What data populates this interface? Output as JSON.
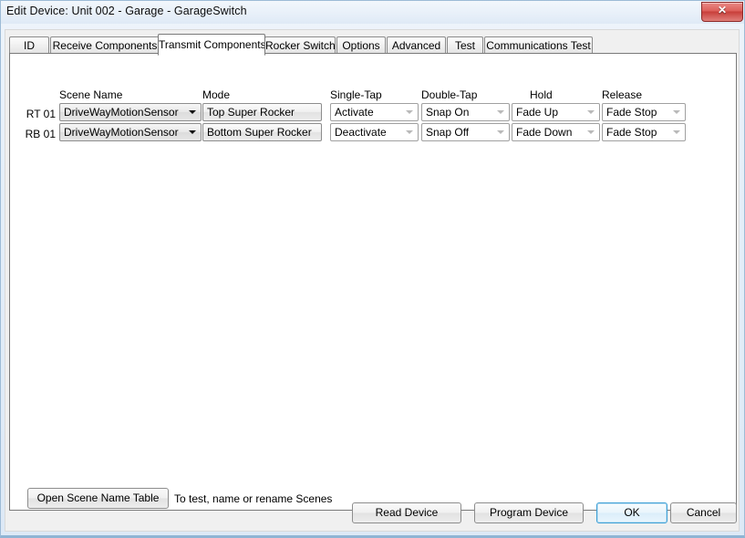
{
  "window": {
    "title": "Edit Device: Unit 002 - Garage - GarageSwitch",
    "close_glyph": "✕"
  },
  "tabs": [
    {
      "label": "ID",
      "active": false
    },
    {
      "label": "Receive Components",
      "active": false
    },
    {
      "label": "Transmit Components",
      "active": true
    },
    {
      "label": "Rocker Switch",
      "active": false
    },
    {
      "label": "Options",
      "active": false
    },
    {
      "label": "Advanced",
      "active": false
    },
    {
      "label": "Test",
      "active": false
    },
    {
      "label": "Communications Test",
      "active": false
    }
  ],
  "grid": {
    "headers": {
      "scene_name": "Scene Name",
      "mode": "Mode",
      "single_tap": "Single-Tap",
      "double_tap": "Double-Tap",
      "hold": "Hold",
      "release": "Release"
    },
    "rows": [
      {
        "label": "RT 01",
        "scene_name": "DriveWayMotionSensor",
        "mode": "Top Super Rocker",
        "single_tap": "Activate",
        "double_tap": "Snap On",
        "hold": "Fade Up",
        "release": "Fade Stop"
      },
      {
        "label": "RB 01",
        "scene_name": "DriveWayMotionSensor",
        "mode": "Bottom Super Rocker",
        "single_tap": "Deactivate",
        "double_tap": "Snap Off",
        "hold": "Fade Down",
        "release": "Fade Stop"
      }
    ]
  },
  "scene_table": {
    "button_label": "Open Scene Name Table",
    "hint": "To test, name or rename Scenes"
  },
  "footer": {
    "read_device": "Read Device",
    "program_device": "Program Device",
    "ok": "OK",
    "cancel": "Cancel"
  },
  "colors": {
    "accent_blue": "#3c9fd6",
    "close_red": "#c83f3a",
    "panel_bg": "#ffffff",
    "dialog_bg": "#f0f0f0"
  }
}
